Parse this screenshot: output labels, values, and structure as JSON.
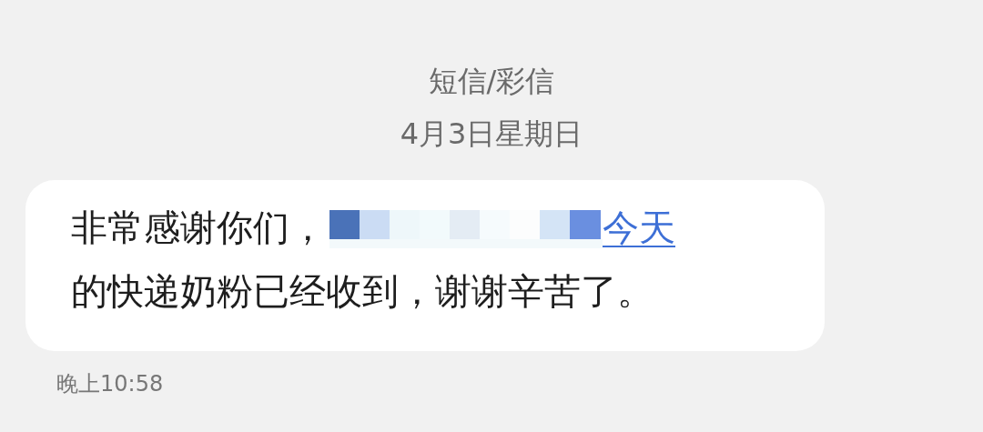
{
  "header": {
    "title": "短信/彩信",
    "date": "4月3日星期日"
  },
  "message": {
    "lead": "非常感谢你们，",
    "redacted": true,
    "link": "今天",
    "tail": "的快递奶粉已经收到，谢谢辛苦了。",
    "time": "晚上10:58"
  }
}
